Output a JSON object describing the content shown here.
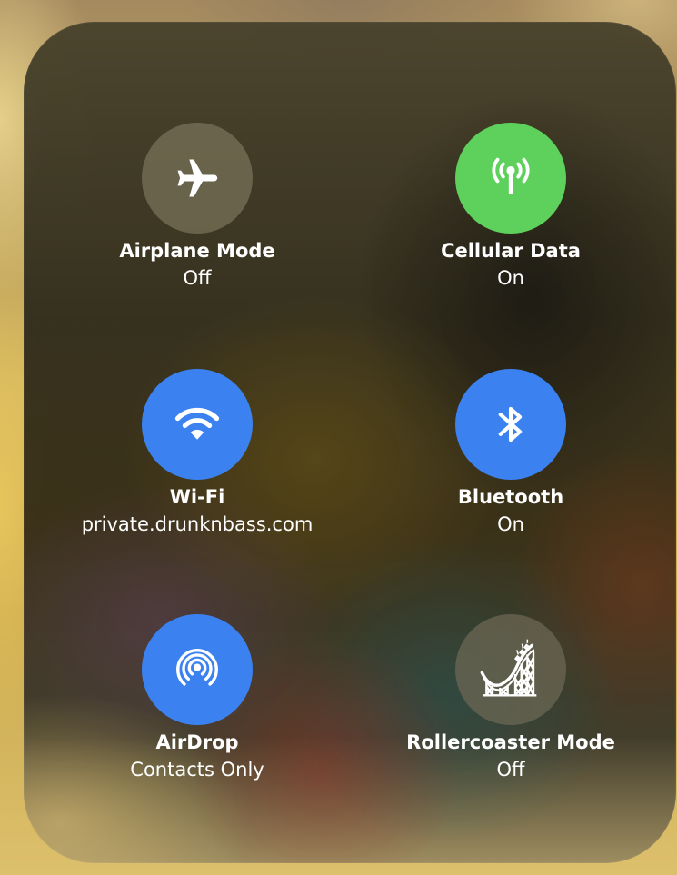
{
  "colors": {
    "inactive": "#6a6550",
    "cellular_green": "#5ed05c",
    "active_blue": "#3b82f0",
    "text": "#ffffff"
  },
  "tiles": [
    {
      "label": "Airplane Mode",
      "status": "Off",
      "icon": "airplane-icon",
      "state": "off"
    },
    {
      "label": "Cellular Data",
      "status": "On",
      "icon": "cellular-antenna-icon",
      "state": "on"
    },
    {
      "label": "Wi-Fi",
      "status": "private.drunknbass.com",
      "icon": "wifi-icon",
      "state": "on"
    },
    {
      "label": "Bluetooth",
      "status": "On",
      "icon": "bluetooth-icon",
      "state": "on"
    },
    {
      "label": "AirDrop",
      "status": "Contacts Only",
      "icon": "airdrop-icon",
      "state": "on"
    },
    {
      "label": "Rollercoaster Mode",
      "status": "Off",
      "icon": "rollercoaster-icon",
      "state": "off"
    }
  ]
}
